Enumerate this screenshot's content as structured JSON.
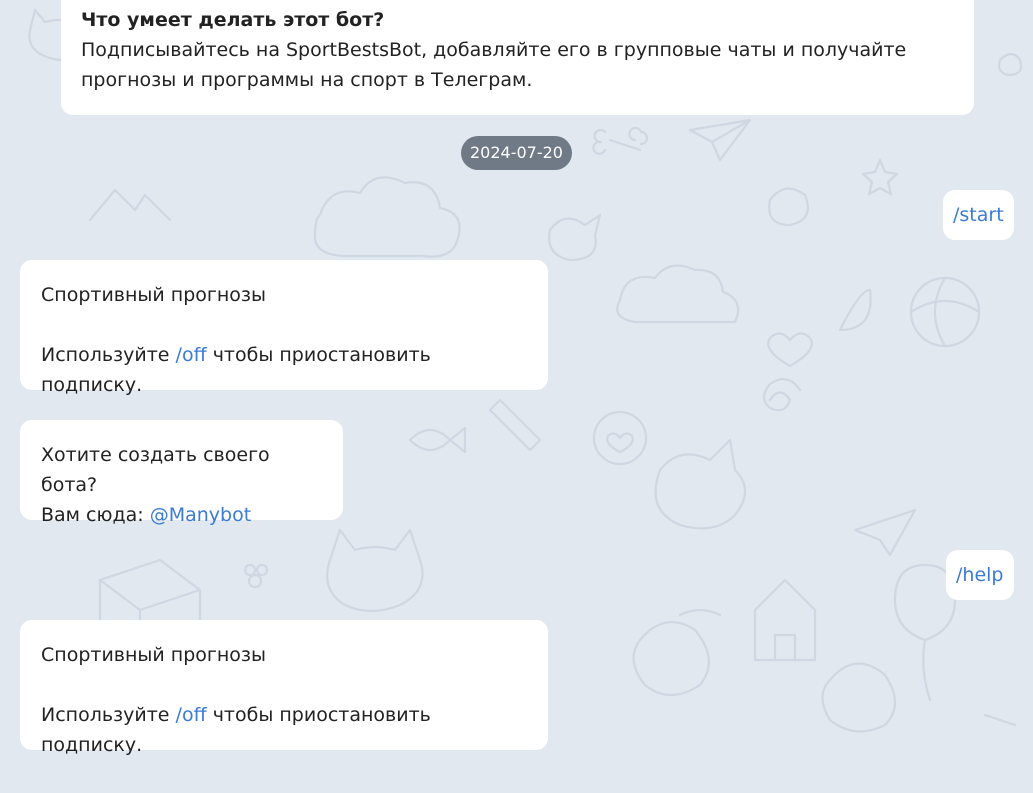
{
  "about": {
    "title": "Что умеет делать этот бот?",
    "line1": "Подписывайтесь на SportBestsBot, добавляйте его в групповые чаты и получайте",
    "line2": "прогнозы и программы на спорт в Телеграм."
  },
  "date_separator": "2024-07-20",
  "messages": [
    {
      "kind": "outgoing",
      "text": "/start"
    },
    {
      "kind": "incoming",
      "line1": "Спортивный прогнозы",
      "line2_prefix": "Используйте ",
      "line2_link": "/off",
      "line2_suffix": " чтобы приостановить подписку."
    },
    {
      "kind": "incoming",
      "line1": "Хотите создать своего бота?",
      "line2_prefix": "Вам сюда: ",
      "line2_link": "@Manybot"
    },
    {
      "kind": "outgoing",
      "text": "/help"
    },
    {
      "kind": "incoming",
      "line1": "Спортивный прогнозы",
      "line2_prefix": "Используйте ",
      "line2_link": "/off",
      "line2_suffix": " чтобы приостановить подписку."
    }
  ],
  "colors": {
    "background": "#e2e8f0",
    "bubble": "#ffffff",
    "link": "#3a7bd5",
    "date_pill": "#6f7a86"
  }
}
